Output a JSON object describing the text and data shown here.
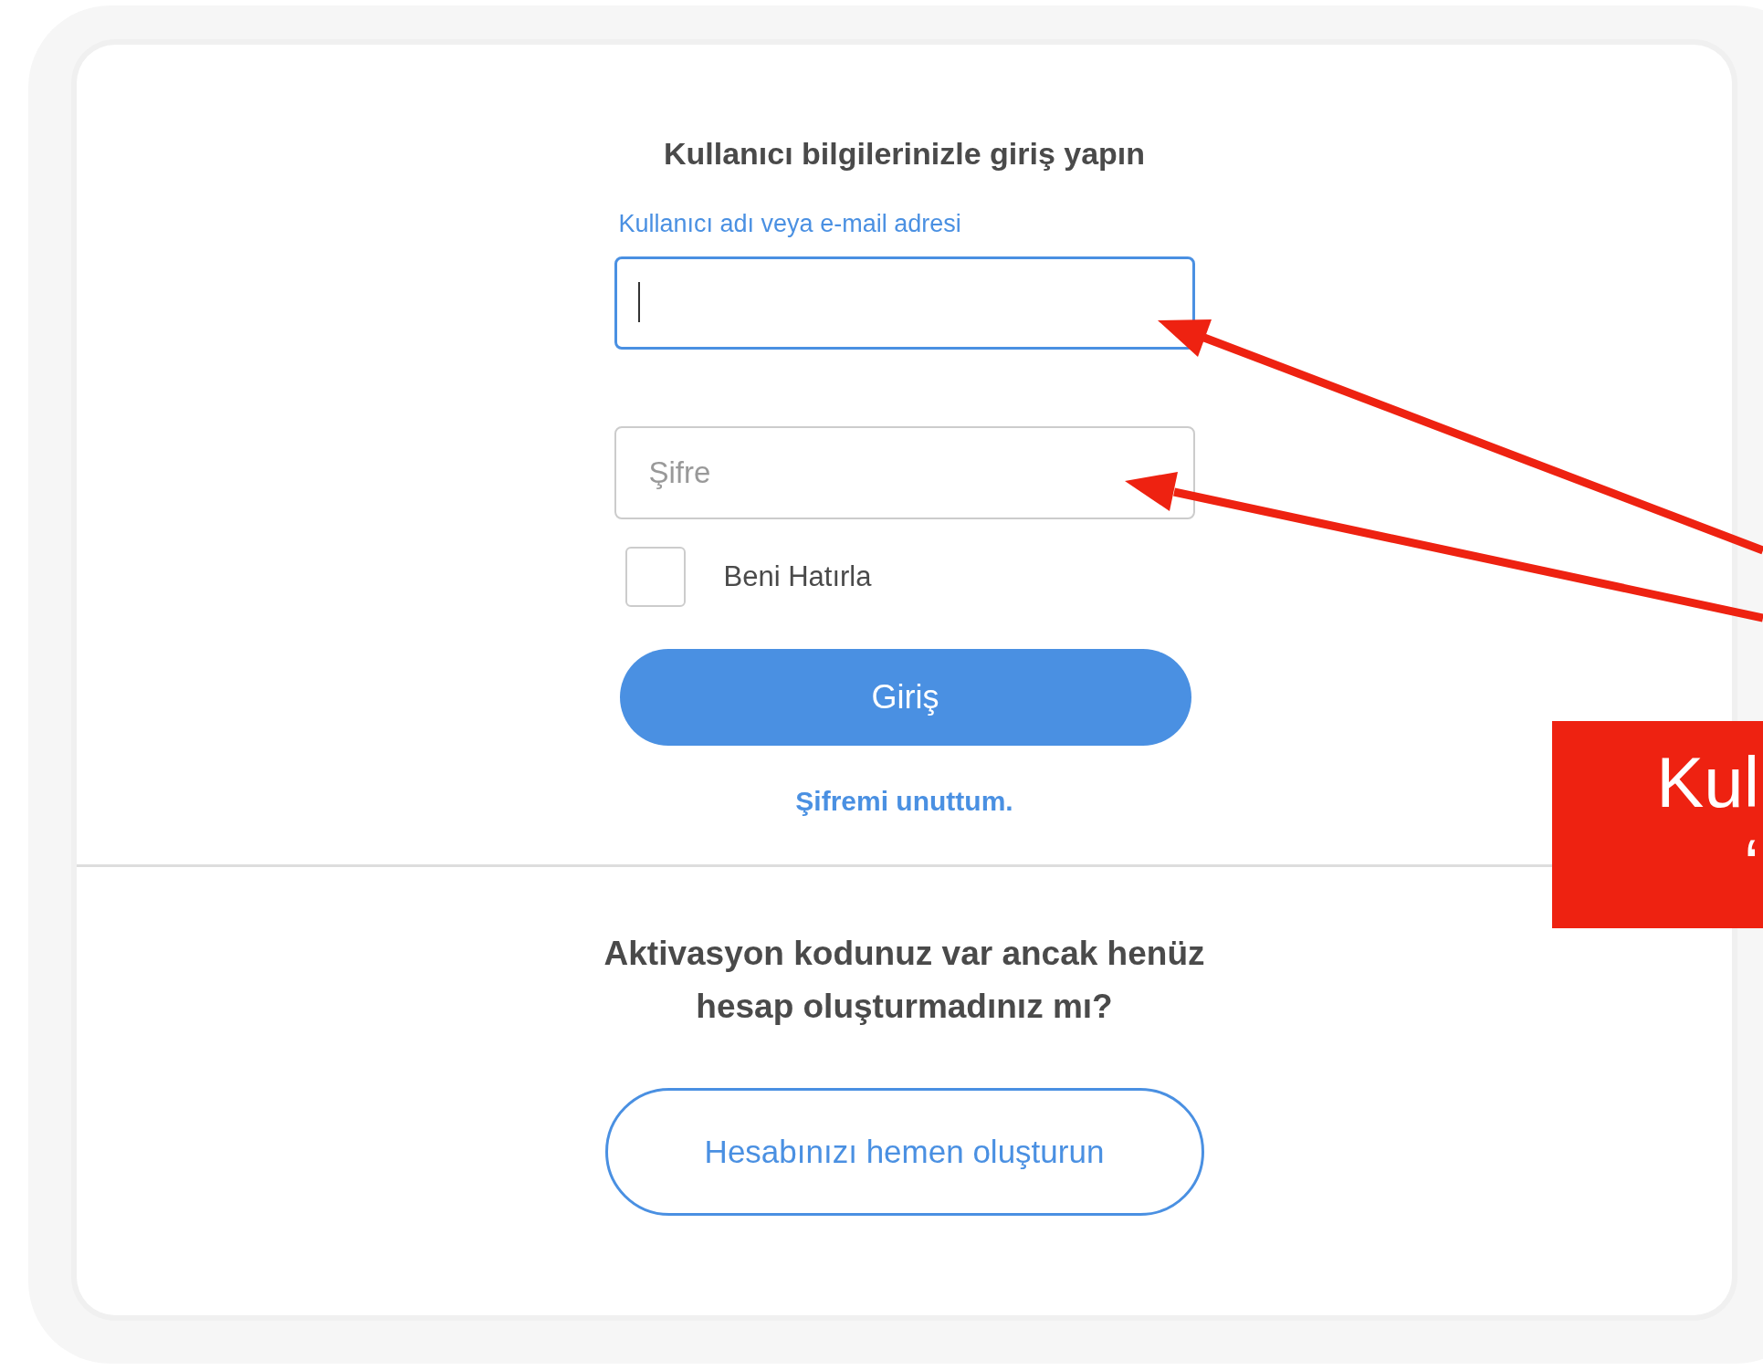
{
  "login_card": {
    "title": "Kullanıcı bilgilerinizle giriş yapın",
    "username_field": {
      "label": "Kullanıcı adı veya e-mail adresi",
      "focused": true
    },
    "password_field": {
      "placeholder": "Şifre",
      "focused": false
    },
    "remember_me": {
      "label": "Beni Hatırla",
      "checked": false
    },
    "login_button": "Giriş",
    "forgot_password_link": "Şifremi unuttum.",
    "activation_question": "Aktivasyon kodunuz var ancak henüz hesap oluşturmadınız mı?",
    "create_account_button": "Hesabınızı hemen oluşturun"
  },
  "annotation": {
    "lines": [
      "Kul",
      "‘"
    ]
  }
}
